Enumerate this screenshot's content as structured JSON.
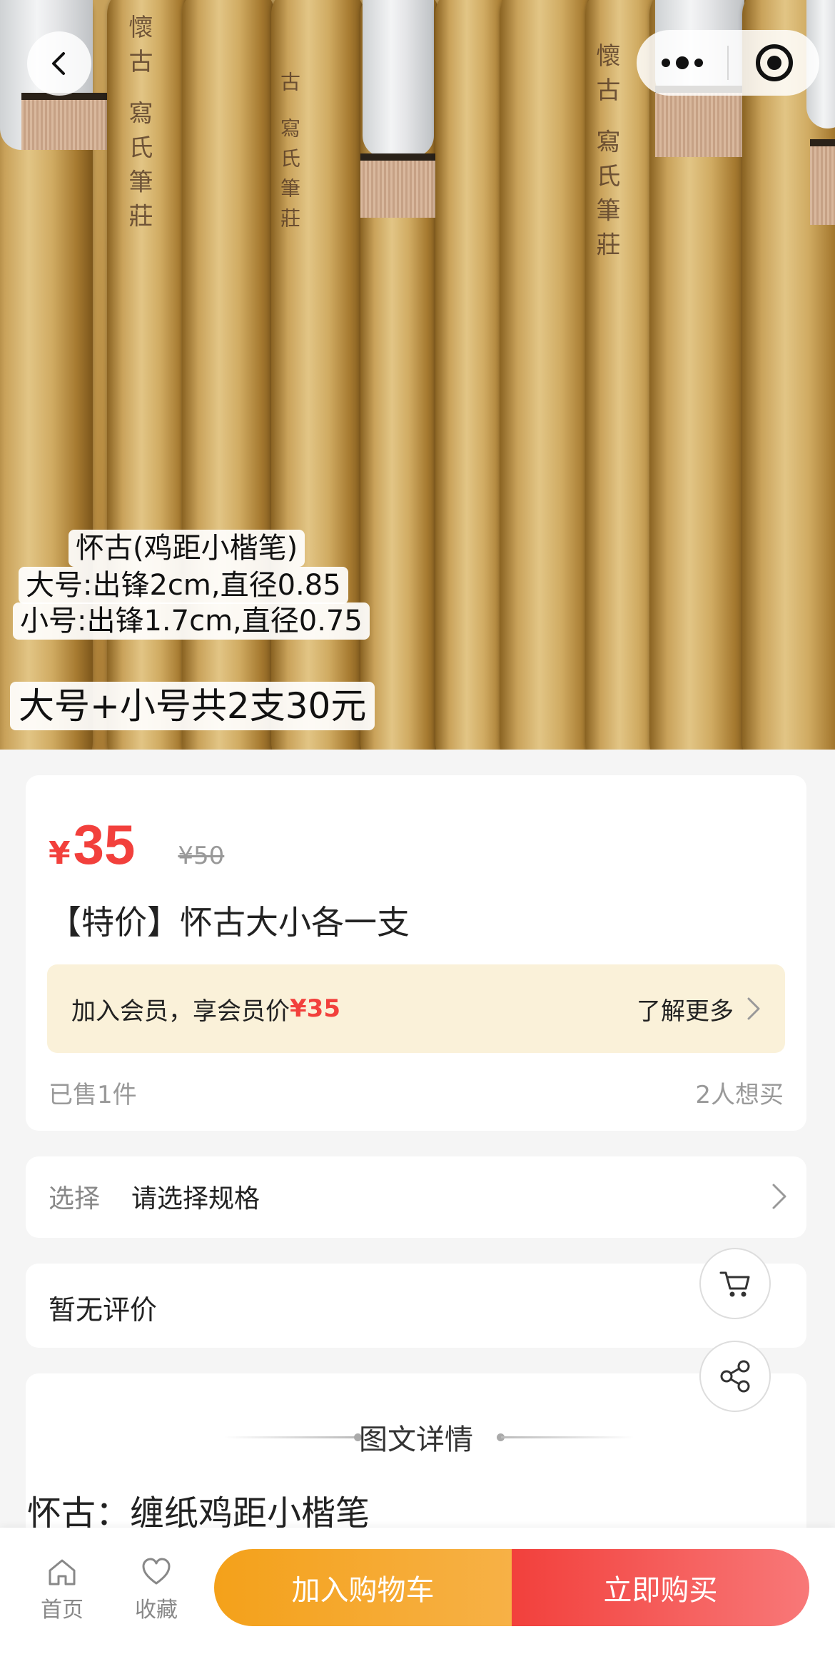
{
  "hero": {
    "label_line1": "怀古(鸡距小楷笔)",
    "label_line2": "大号:出锋2cm,直径0.85",
    "label_line3": "小号:出锋1.7cm,直径0.75",
    "label_price": "大号+小号共2支30元"
  },
  "product": {
    "price_symbol": "¥",
    "price": "35",
    "original_price": "¥50",
    "title": "【特价】怀古大小各一支",
    "member_text": "加入会员，享会员价",
    "member_price": "¥35",
    "member_more": "了解更多",
    "sold": "已售1件",
    "wanted": "2人想买"
  },
  "spec": {
    "label": "选择",
    "value": "请选择规格"
  },
  "reviews": {
    "label": "暂无评价"
  },
  "detail": {
    "title": "图文详情",
    "first_line": "怀古：缠纸鸡距小楷笔"
  },
  "tabbar": {
    "home": "首页",
    "favorite": "收藏"
  },
  "actions": {
    "add_cart": "加入购物车",
    "buy_now": "立即购买"
  },
  "colors": {
    "accent_red": "#f2403c",
    "accent_orange": "#f4a11a",
    "member_bg": "#faf1d9"
  }
}
